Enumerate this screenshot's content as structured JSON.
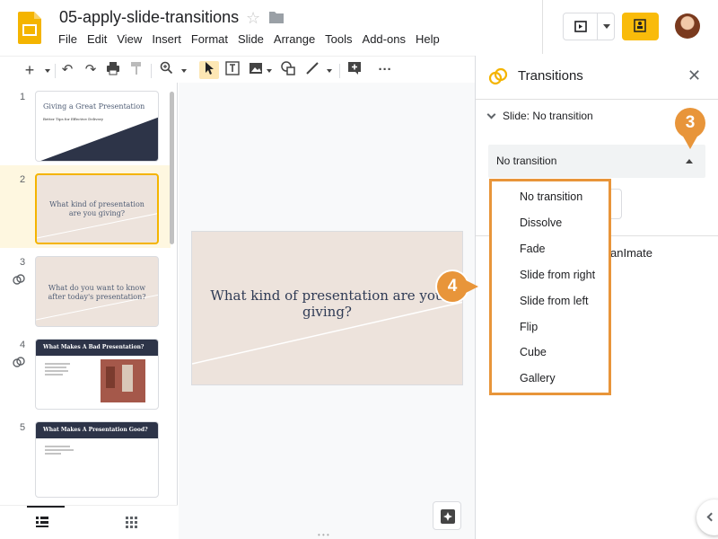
{
  "header": {
    "doc_title": "05-apply-slide-transitions",
    "icons": [
      "slides-logo-icon",
      "star-icon",
      "folder-icon",
      "present-icon",
      "share-icon",
      "avatar"
    ]
  },
  "menubar": {
    "items": [
      "File",
      "Edit",
      "View",
      "Insert",
      "Format",
      "Slide",
      "Arrange",
      "Tools",
      "Add-ons",
      "Help"
    ]
  },
  "filmstrip": {
    "slides": [
      {
        "number": "1",
        "title": "Giving a Great Presentation",
        "subtitle": "Better Tips for Effective Delivery"
      },
      {
        "number": "2",
        "title": "What kind of presentation are you giving?"
      },
      {
        "number": "3",
        "title": "What do you want to know after today's presentation?"
      },
      {
        "number": "4",
        "title": "What Makes A Bad Presentation?"
      },
      {
        "number": "5",
        "title": "What Makes A Presentation Good?"
      }
    ]
  },
  "canvas": {
    "slide_text": "What kind of presentation are you giving?"
  },
  "panel": {
    "title": "Transitions",
    "section_label": "Slide: No transition",
    "selected_transition": "No transition",
    "partial_label": "anImate"
  },
  "dropdown": {
    "options": [
      "No transition",
      "Dissolve",
      "Fade",
      "Slide from right",
      "Slide from left",
      "Flip",
      "Cube",
      "Gallery"
    ]
  },
  "callouts": {
    "step3": "3",
    "step4": "4"
  },
  "colors": {
    "accent_orange": "#e8953a",
    "slides_yellow": "#f4b400",
    "slide_background": "#ede3dc",
    "slide_text": "#2f3b55"
  }
}
